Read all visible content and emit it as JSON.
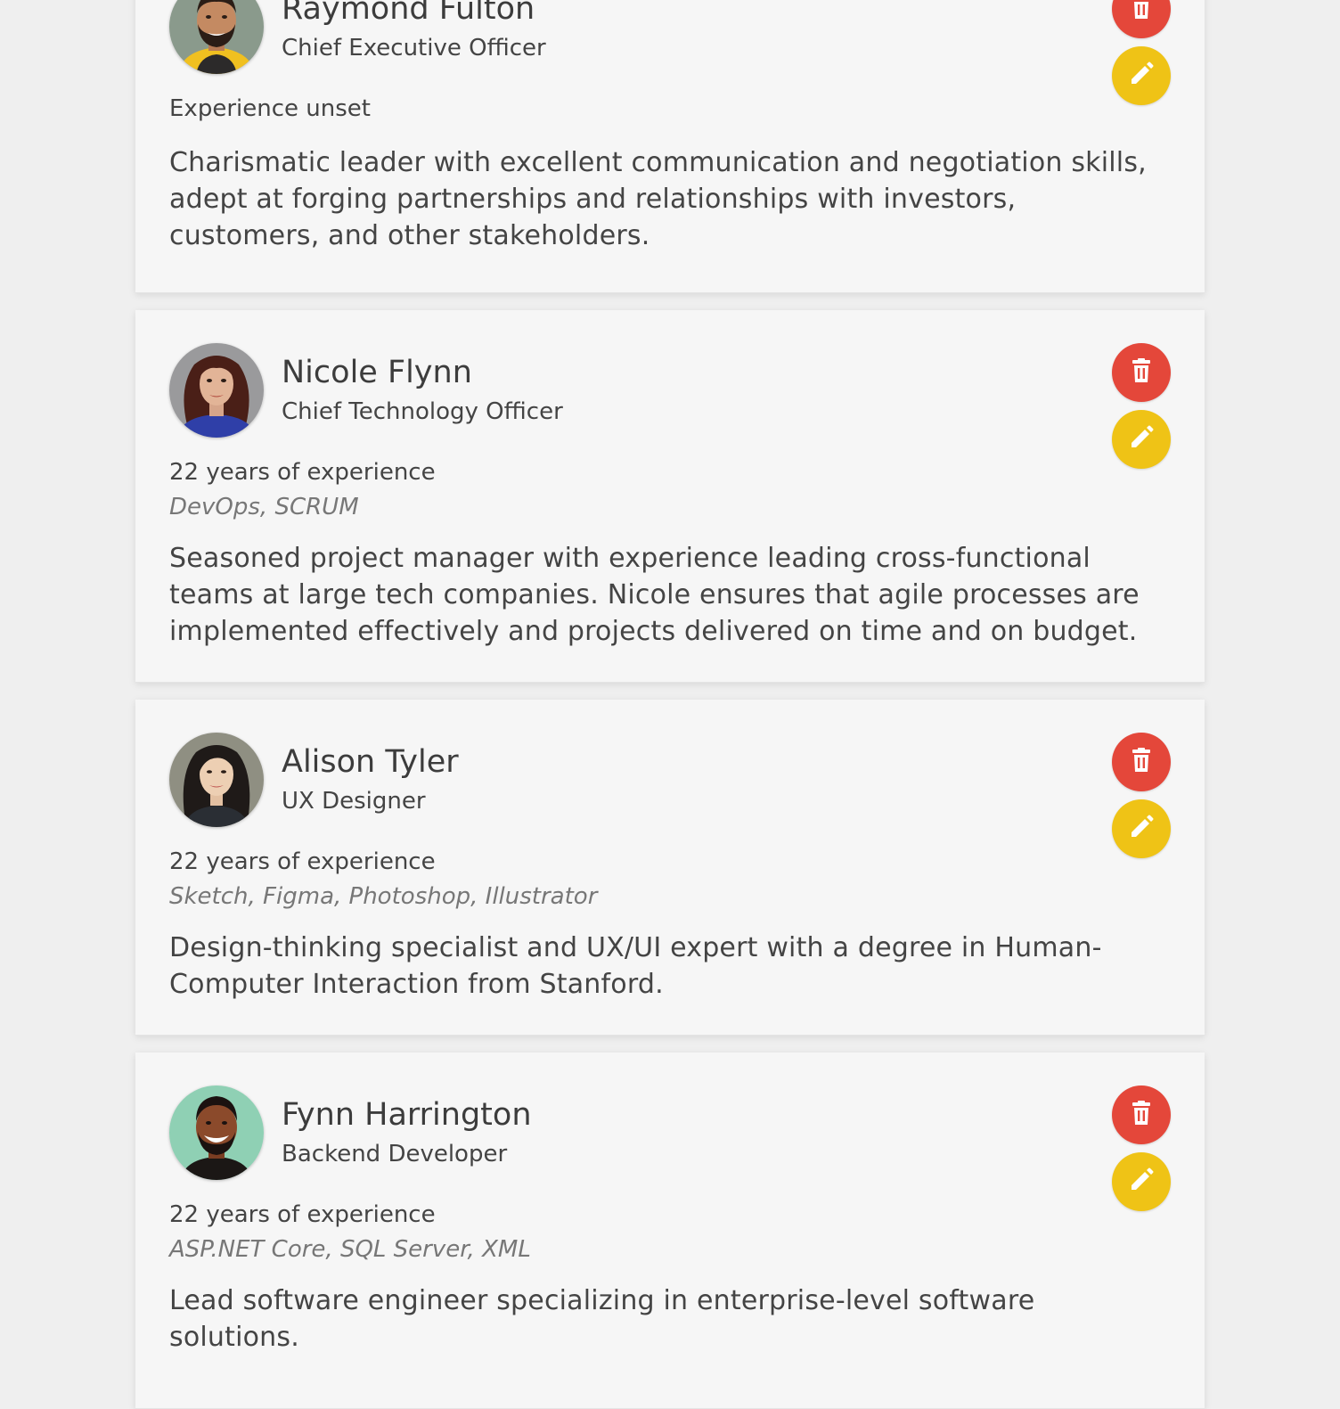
{
  "colors": {
    "delete_button": "#e4473a",
    "edit_button": "#efc316",
    "card_background": "#f6f6f6",
    "page_background": "#efefef"
  },
  "icons": {
    "delete": "trash-icon",
    "edit": "pencil-icon"
  },
  "people": [
    {
      "name": "Raymond Fulton",
      "role": "Chief Executive Officer",
      "experience": "Experience unset",
      "skills": "",
      "bio": "Charismatic leader with excellent communication and negotiation skills, adept at forging partnerships and relationships with investors, customers, and other stakeholders."
    },
    {
      "name": "Nicole Flynn",
      "role": "Chief Technology Officer",
      "experience": "22 years of experience",
      "skills": "DevOps, SCRUM",
      "bio": "Seasoned project manager with experience leading cross-functional teams at large tech companies. Nicole ensures that agile processes are implemented effectively and projects delivered on time and on budget."
    },
    {
      "name": "Alison Tyler",
      "role": "UX Designer",
      "experience": "22 years of experience",
      "skills": "Sketch, Figma, Photoshop, Illustrator",
      "bio": "Design-thinking specialist and UX/UI expert with a degree in Human-Computer Interaction from Stanford."
    },
    {
      "name": "Fynn Harrington",
      "role": "Backend Developer",
      "experience": "22 years of experience",
      "skills": "ASP.NET Core, SQL Server, XML",
      "bio": "Lead software engineer specializing in enterprise-level software solutions."
    }
  ]
}
